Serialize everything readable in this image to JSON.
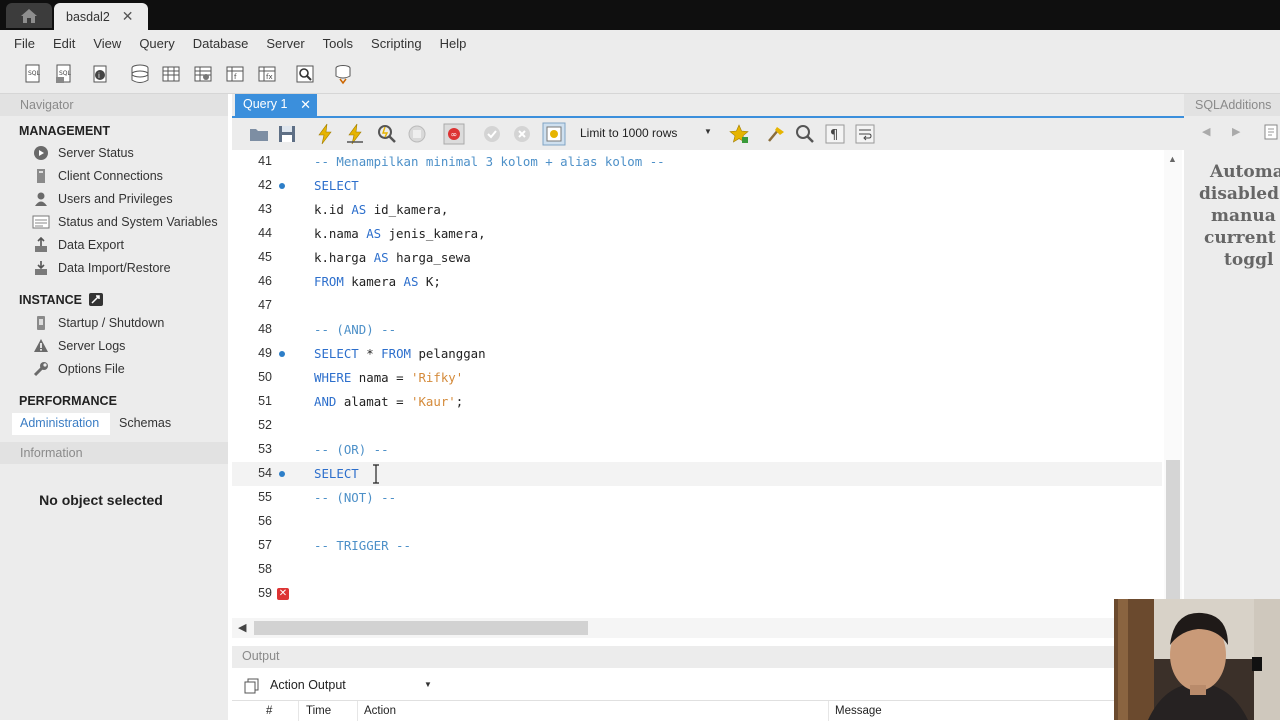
{
  "window": {
    "tab_title": "basdal2",
    "tab_close": "✕"
  },
  "menu": [
    "File",
    "Edit",
    "View",
    "Query",
    "Database",
    "Server",
    "Tools",
    "Scripting",
    "Help"
  ],
  "navigator": {
    "header": "Navigator",
    "management_title": "MANAGEMENT",
    "management_items": [
      "Server Status",
      "Client Connections",
      "Users and Privileges",
      "Status and System Variables",
      "Data Export",
      "Data Import/Restore"
    ],
    "instance_title": "INSTANCE",
    "instance_items": [
      "Startup / Shutdown",
      "Server Logs",
      "Options File"
    ],
    "performance_title": "PERFORMANCE",
    "tabs": [
      "Administration",
      "Schemas"
    ],
    "information_header": "Information",
    "no_object": "No object selected"
  },
  "editor": {
    "query_tab": "Query 1",
    "query_tab_close": "✕",
    "limit_label": "Limit to 1000 rows",
    "current_line": 54,
    "lines": [
      {
        "n": "41",
        "text": "-- Menampilkan minimal 3 kolom + alias kolom --"
      },
      {
        "n": "42",
        "text": "SELECT"
      },
      {
        "n": "43",
        "text": "k.id AS id_kamera,"
      },
      {
        "n": "44",
        "text": "k.nama AS jenis_kamera,"
      },
      {
        "n": "45",
        "text": "k.harga AS harga_sewa"
      },
      {
        "n": "46",
        "text": "FROM kamera AS K;"
      },
      {
        "n": "47",
        "text": ""
      },
      {
        "n": "48",
        "text": "-- (AND) --"
      },
      {
        "n": "49",
        "text": "SELECT * FROM pelanggan"
      },
      {
        "n": "50",
        "text": "WHERE nama = 'Rifky'"
      },
      {
        "n": "51",
        "text": "AND alamat = 'Kaur';"
      },
      {
        "n": "52",
        "text": ""
      },
      {
        "n": "53",
        "text": "-- (OR) --"
      },
      {
        "n": "54",
        "text": "SELECT"
      },
      {
        "n": "55",
        "text": "-- (NOT) --"
      },
      {
        "n": "56",
        "text": ""
      },
      {
        "n": "57",
        "text": "-- TRIGGER --"
      },
      {
        "n": "58",
        "text": ""
      },
      {
        "n": "59",
        "text": ""
      }
    ]
  },
  "output": {
    "header": "Output",
    "select_value": "Action Output",
    "columns": [
      "#",
      "Time",
      "Action",
      "Message"
    ]
  },
  "sql_additions": {
    "header": "SQLAdditions",
    "message_lines": [
      "Automa",
      "disabled",
      "manua",
      "current",
      "toggl"
    ]
  },
  "colors": {
    "accent": "#3b8fdc",
    "keyword": "#2d6fcc",
    "comment": "#4d90c8",
    "string": "#d48a3a"
  }
}
